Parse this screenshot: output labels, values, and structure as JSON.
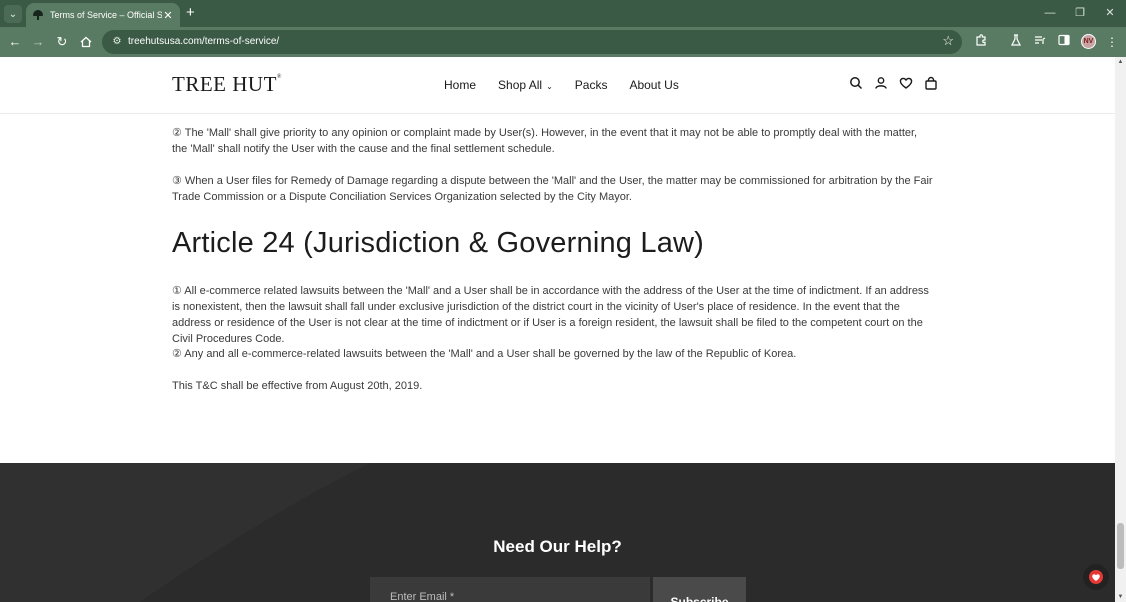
{
  "browser": {
    "tab_title": "Terms of Service – Official Store",
    "url": "treehutsusa.com/terms-of-service/",
    "new_tab_glyph": "+",
    "profile_initials": "NV"
  },
  "header": {
    "logo_text": "TREE HUT",
    "logo_mark": "®",
    "nav": {
      "home": "Home",
      "shop_all": "Shop All",
      "packs": "Packs",
      "about": "About Us"
    },
    "icons": [
      "search-icon",
      "account-icon",
      "wishlist-heart-icon",
      "cart-bag-icon"
    ]
  },
  "article": {
    "p23_2": "② The 'Mall' shall give priority to any opinion or complaint made by User(s). However, in the event that it may not be able to promptly deal with the matter, the 'Mall' shall notify the User with the cause and the final settlement schedule.",
    "p23_3": "③ When a User files for Remedy of Damage regarding a dispute between the 'Mall' and the User, the matter may be commissioned for arbitration by the Fair Trade Commission or a Dispute Conciliation Services Organization selected by the City Mayor.",
    "heading_24": "Article 24 (Jurisdiction & Governing Law)",
    "p24_1": "① All e-commerce related lawsuits between the 'Mall' and a User shall be in accordance with the address of the User at the time of indictment. If an address is nonexistent, then the lawsuit shall fall under exclusive jurisdiction of the district court in the vicinity of User's place of residence. In the event that the address or residence of the User is not clear at the time of indictment or if User is a foreign resident, the lawsuit shall be filed to the competent court on the Civil Procedures Code.",
    "p24_2": "② Any and all e-commerce-related lawsuits between the 'Mall' and a User shall be governed by the law of the Republic of Korea.",
    "effective": "This T&C shall be effective from August 20th, 2019."
  },
  "footer": {
    "title": "Need Our Help?",
    "email_placeholder": "Enter Email *",
    "subscribe_label": "Subscribe"
  },
  "colors": {
    "chrome_dark": "#3b5a45",
    "chrome_light": "#5a7b63",
    "footer_bg": "#2b2b2b",
    "fab_accent": "#e53935"
  }
}
